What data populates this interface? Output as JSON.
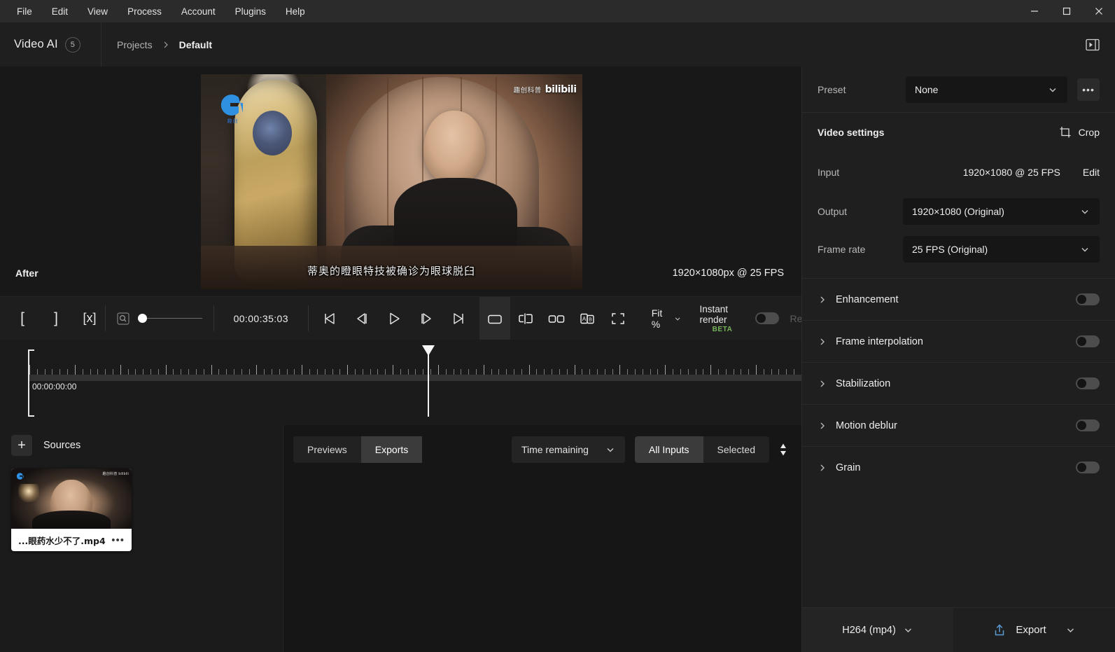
{
  "menubar": {
    "items": [
      "File",
      "Edit",
      "View",
      "Process",
      "Account",
      "Plugins",
      "Help"
    ],
    "window_controls": {
      "minimize": "minimize-icon",
      "maximize": "maximize-icon",
      "close": "close-icon"
    }
  },
  "header": {
    "brand": "Video AI",
    "brand_badge": "5",
    "breadcrumb": [
      "Projects",
      "Default"
    ],
    "panel_toggle_icon": "panel-toggle-icon"
  },
  "preview": {
    "after_label": "After",
    "resolution_label": "1920×1080px @ 25 FPS",
    "subtitle": "蒂奥的瞪眼特技被确诊为眼球脱臼",
    "watermark_cn": "趣创科普",
    "watermark_brand": "bilibili",
    "logo_sub": "趣创"
  },
  "toolbar": {
    "mark_in": "[",
    "mark_out": "]",
    "clear_marks": "[x]",
    "zoom_icon": "zoom-fit-icon",
    "timecode": "00:00:35:03",
    "transport": [
      "skip-to-start-icon",
      "step-back-icon",
      "play-icon",
      "step-forward-icon",
      "skip-to-end-icon"
    ],
    "view_modes": [
      "single-view-icon",
      "split-view-icon",
      "side-by-side-icon",
      "a-b-compare-icon",
      "fullscreen-icon"
    ],
    "fit_label": "Fit %",
    "instant_render_label": "Instant render",
    "instant_render_badge": "BETA",
    "instant_render_on": false,
    "truncated_label": "Ren"
  },
  "timeline": {
    "start_timecode": "00:00:00:00"
  },
  "sources": {
    "title": "Sources",
    "add_label": "+",
    "items": [
      {
        "name": "...眼药水少不了.mp4",
        "menu": "•••",
        "watermark": "趣创科普 bilibili"
      }
    ]
  },
  "queue": {
    "tabs": [
      {
        "label": "Previews",
        "selected": false
      },
      {
        "label": "Exports",
        "selected": true
      }
    ],
    "sort_dropdown": "Time remaining",
    "filters": [
      {
        "label": "All Inputs",
        "selected": true
      },
      {
        "label": "Selected",
        "selected": false
      }
    ],
    "sort_icon": "sort-arrows-icon"
  },
  "right_panel": {
    "preset": {
      "label": "Preset",
      "value": "None",
      "more": "•••"
    },
    "video_settings": {
      "label": "Video settings",
      "crop_label": "Crop",
      "crop_icon": "crop-icon"
    },
    "input": {
      "label": "Input",
      "value": "1920×1080 @ 25 FPS",
      "edit_label": "Edit"
    },
    "output": {
      "label": "Output",
      "value": "1920×1080 (Original)"
    },
    "frame_rate": {
      "label": "Frame rate",
      "value": "25 FPS (Original)"
    },
    "sections": [
      {
        "label": "Enhancement",
        "enabled": false
      },
      {
        "label": "Frame interpolation",
        "enabled": false
      },
      {
        "label": "Stabilization",
        "enabled": false
      },
      {
        "label": "Motion deblur",
        "enabled": false
      },
      {
        "label": "Grain",
        "enabled": false
      }
    ],
    "export_bar": {
      "codec": "H264 (mp4)",
      "export_label": "Export",
      "export_icon": "share-export-icon"
    }
  },
  "colors": {
    "accent_blue": "#5b9bd5",
    "beta_green": "#76b35a",
    "panel_bg": "#1f1f1f",
    "app_bg": "#1b1b1b",
    "menubar_bg": "#2b2b2b"
  }
}
